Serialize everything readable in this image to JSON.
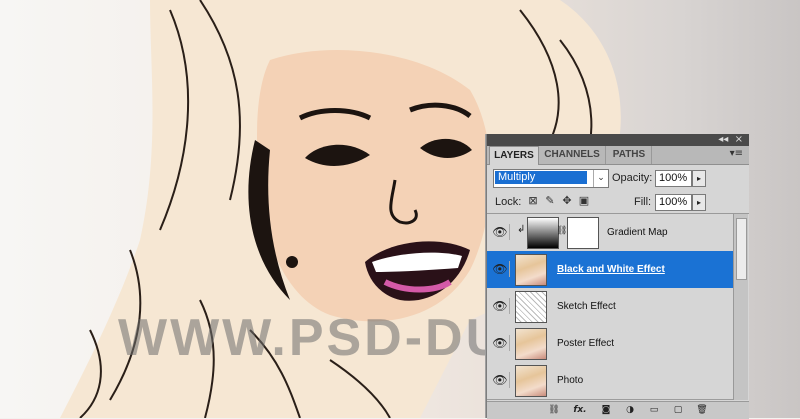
{
  "watermark": "WWW.PSD-DUDE.COM",
  "panel": {
    "tabs": [
      "LAYERS",
      "CHANNELS",
      "PATHS"
    ],
    "blend_mode": "Multiply",
    "opacity_label": "Opacity:",
    "opacity_value": "100%",
    "lock_label": "Lock:",
    "fill_label": "Fill:",
    "fill_value": "100%",
    "layers": [
      {
        "name": "Gradient Map",
        "selected": false,
        "thumb": "gradient"
      },
      {
        "name": "Black and White Effect",
        "selected": true,
        "thumb": "photo"
      },
      {
        "name": "Sketch Effect",
        "selected": false,
        "thumb": "sketch"
      },
      {
        "name": "Poster Effect",
        "selected": false,
        "thumb": "photo"
      },
      {
        "name": "Photo",
        "selected": false,
        "thumb": "photo"
      }
    ],
    "icons": {
      "collapse": "double-left-arrow",
      "close": "close-x",
      "menu": "panel-menu",
      "eye": "eye",
      "link": "link-chain",
      "fx": "fx",
      "mask": "mask",
      "adjust": "half-circle",
      "group": "folder",
      "new": "new-layer",
      "trash": "trash"
    },
    "colors": {
      "selected": "#1a72d4"
    }
  }
}
